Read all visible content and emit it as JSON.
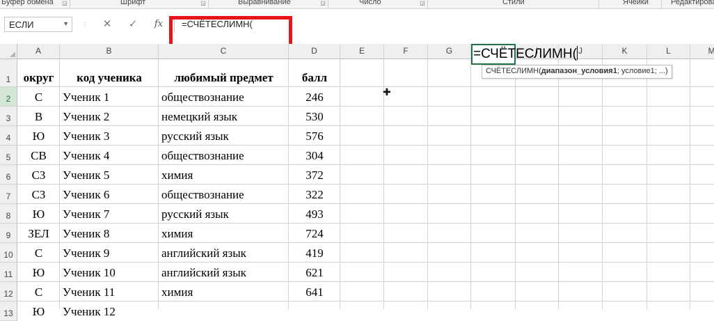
{
  "ribbon": {
    "groups": [
      "Буфер обмена",
      "Шрифт",
      "Выравнивание",
      "Число",
      "Стили",
      "Ячейки",
      "Редактирование"
    ]
  },
  "formula_bar": {
    "name_box": "ЕСЛИ",
    "cancel": "✕",
    "enter": "✓",
    "fx": "fx",
    "formula": "=СЧЁТЕСЛИМН("
  },
  "columns": [
    "A",
    "B",
    "C",
    "D",
    "E",
    "F",
    "G",
    "H",
    "I",
    "J",
    "K",
    "L",
    "M"
  ],
  "rows": [
    "1",
    "2",
    "3",
    "4",
    "5",
    "6",
    "7",
    "8",
    "9",
    "10",
    "11",
    "12",
    "13"
  ],
  "table": {
    "headers": [
      "округ",
      "код ученика",
      "любимый предмет",
      "балл"
    ],
    "data": [
      [
        "С",
        "Ученик 1",
        "обществознание",
        "246"
      ],
      [
        "В",
        "Ученик 2",
        "немецкий язык",
        "530"
      ],
      [
        "Ю",
        "Ученик 3",
        "русский язык",
        "576"
      ],
      [
        "СВ",
        "Ученик 4",
        "обществознание",
        "304"
      ],
      [
        "СЗ",
        "Ученик 5",
        "химия",
        "372"
      ],
      [
        "СЗ",
        "Ученик 6",
        "обществознание",
        "322"
      ],
      [
        "Ю",
        "Ученик 7",
        "русский язык",
        "493"
      ],
      [
        "ЗЕЛ",
        "Ученик 8",
        "химия",
        "724"
      ],
      [
        "С",
        "Ученик 9",
        "английский язык",
        "419"
      ],
      [
        "Ю",
        "Ученик 10",
        "английский язык",
        "621"
      ],
      [
        "С",
        "Ученик 11",
        "химия",
        "641"
      ],
      [
        "Ю",
        "Ученик 12",
        "",
        ""
      ]
    ]
  },
  "active_cell": {
    "content": "=СЧЁТЕСЛИМН(",
    "tooltip_fn": "СЧЁТЕСЛИМН(",
    "tooltip_arg_bold": "диапазон_условия1",
    "tooltip_rest": "; условие1; ...)"
  },
  "colors": {
    "accent": "#217346",
    "highlight": "#e8141a"
  }
}
